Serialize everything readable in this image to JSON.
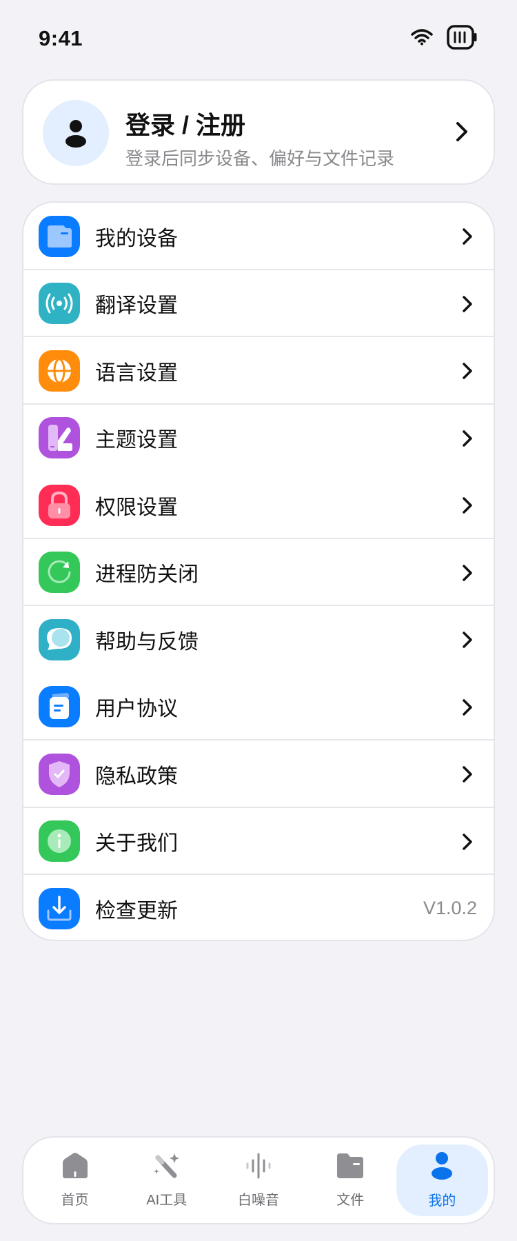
{
  "status_bar": {
    "time": "9:41"
  },
  "login": {
    "title": "登录 / 注册",
    "subtitle": "登录后同步设备、偏好与文件记录"
  },
  "menu": {
    "items": [
      {
        "label": "我的设备",
        "icon": "folder-icon",
        "color": "#0a7cff"
      },
      {
        "label": "翻译设置",
        "icon": "broadcast-icon",
        "color": "#2fb3c4"
      },
      {
        "label": "语言设置",
        "icon": "globe-icon",
        "color": "#ff8c0a"
      },
      {
        "label": "主题设置",
        "icon": "brush-icon",
        "color": "#af52de"
      },
      {
        "label": "权限设置",
        "icon": "lock-icon",
        "color": "#ff2d55"
      },
      {
        "label": "进程防关闭",
        "icon": "refresh-icon",
        "color": "#34c759"
      },
      {
        "label": "帮助与反馈",
        "icon": "chat-bubble-icon",
        "color": "#30b0c7"
      },
      {
        "label": "用户协议",
        "icon": "document-icon",
        "color": "#0a7cff"
      },
      {
        "label": "隐私政策",
        "icon": "shield-icon",
        "color": "#af52de"
      },
      {
        "label": "关于我们",
        "icon": "info-icon",
        "color": "#34c759"
      },
      {
        "label": "检查更新",
        "icon": "download-icon",
        "color": "#0a7cff",
        "value": "V1.0.2"
      }
    ]
  },
  "tab_bar": {
    "tabs": [
      {
        "label": "首页",
        "icon": "home-icon",
        "active": false
      },
      {
        "label": "AI工具",
        "icon": "magic-wand-icon",
        "active": false
      },
      {
        "label": "白噪音",
        "icon": "waveform-icon",
        "active": false
      },
      {
        "label": "文件",
        "icon": "folder-icon",
        "active": false
      },
      {
        "label": "我的",
        "icon": "person-icon",
        "active": true
      }
    ]
  },
  "colors": {
    "accent": "#0a72ea",
    "background": "#f2f2f7"
  }
}
